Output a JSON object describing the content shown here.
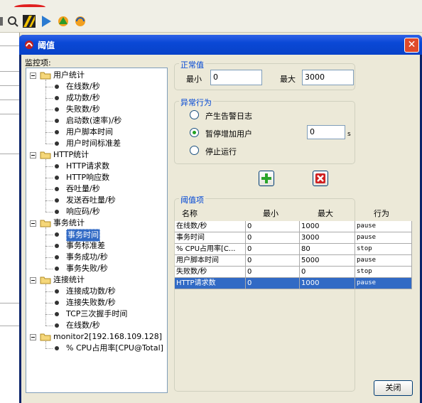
{
  "dialog": {
    "title": "阈值",
    "close_label": "关闭"
  },
  "tree": {
    "label": "监控项:",
    "groups": [
      {
        "label": "用户统计",
        "items": [
          "在线数/秒",
          "成功数/秒",
          "失败数/秒",
          "启动数(速率)/秒",
          "用户脚本时间",
          "用户时间标准差"
        ]
      },
      {
        "label": "HTTP统计",
        "items": [
          "HTTP请求数",
          "HTTP响应数",
          "吞吐量/秒",
          "发送吞吐量/秒",
          "响应码/秒"
        ]
      },
      {
        "label": "事务统计",
        "items": [
          "事务时间",
          "事务标准差",
          "事务成功/秒",
          "事务失败/秒"
        ]
      },
      {
        "label": "连接统计",
        "items": [
          "连接成功数/秒",
          "连接失败数/秒",
          "TCP三次握手时间",
          "在线数/秒"
        ]
      },
      {
        "label": "monitor2[192.168.109.128]",
        "items": [
          "% CPU占用率[CPU@Total]"
        ]
      }
    ],
    "selected": "事务时间"
  },
  "normal": {
    "label": "正常值",
    "min_label": "最小",
    "min_value": "0",
    "max_label": "最大",
    "max_value": "3000"
  },
  "abnormal": {
    "label": "异常行为",
    "options": [
      "产生告警日志",
      "暂停增加用户",
      "停止运行"
    ],
    "selected_index": 1,
    "pause_value": "0",
    "pause_unit": "s"
  },
  "thresholds": {
    "label": "阈值项",
    "columns": [
      "名称",
      "最小",
      "最大",
      "行为"
    ],
    "rows": [
      [
        "在线数/秒",
        "0",
        "1000",
        "pause"
      ],
      [
        "事务时间",
        "0",
        "3000",
        "pause"
      ],
      [
        "% CPU占用率[C...",
        "0",
        "80",
        "stop"
      ],
      [
        "用户脚本时间",
        "0",
        "5000",
        "pause"
      ],
      [
        "失败数/秒",
        "0",
        "0",
        "stop"
      ],
      [
        "HTTP请求数",
        "0",
        "1000",
        "pause"
      ]
    ],
    "selected_row": 5
  },
  "colors": {
    "title_bar": "#0a48d6",
    "selection": "#316ac5",
    "group_label": "#0046d5"
  }
}
